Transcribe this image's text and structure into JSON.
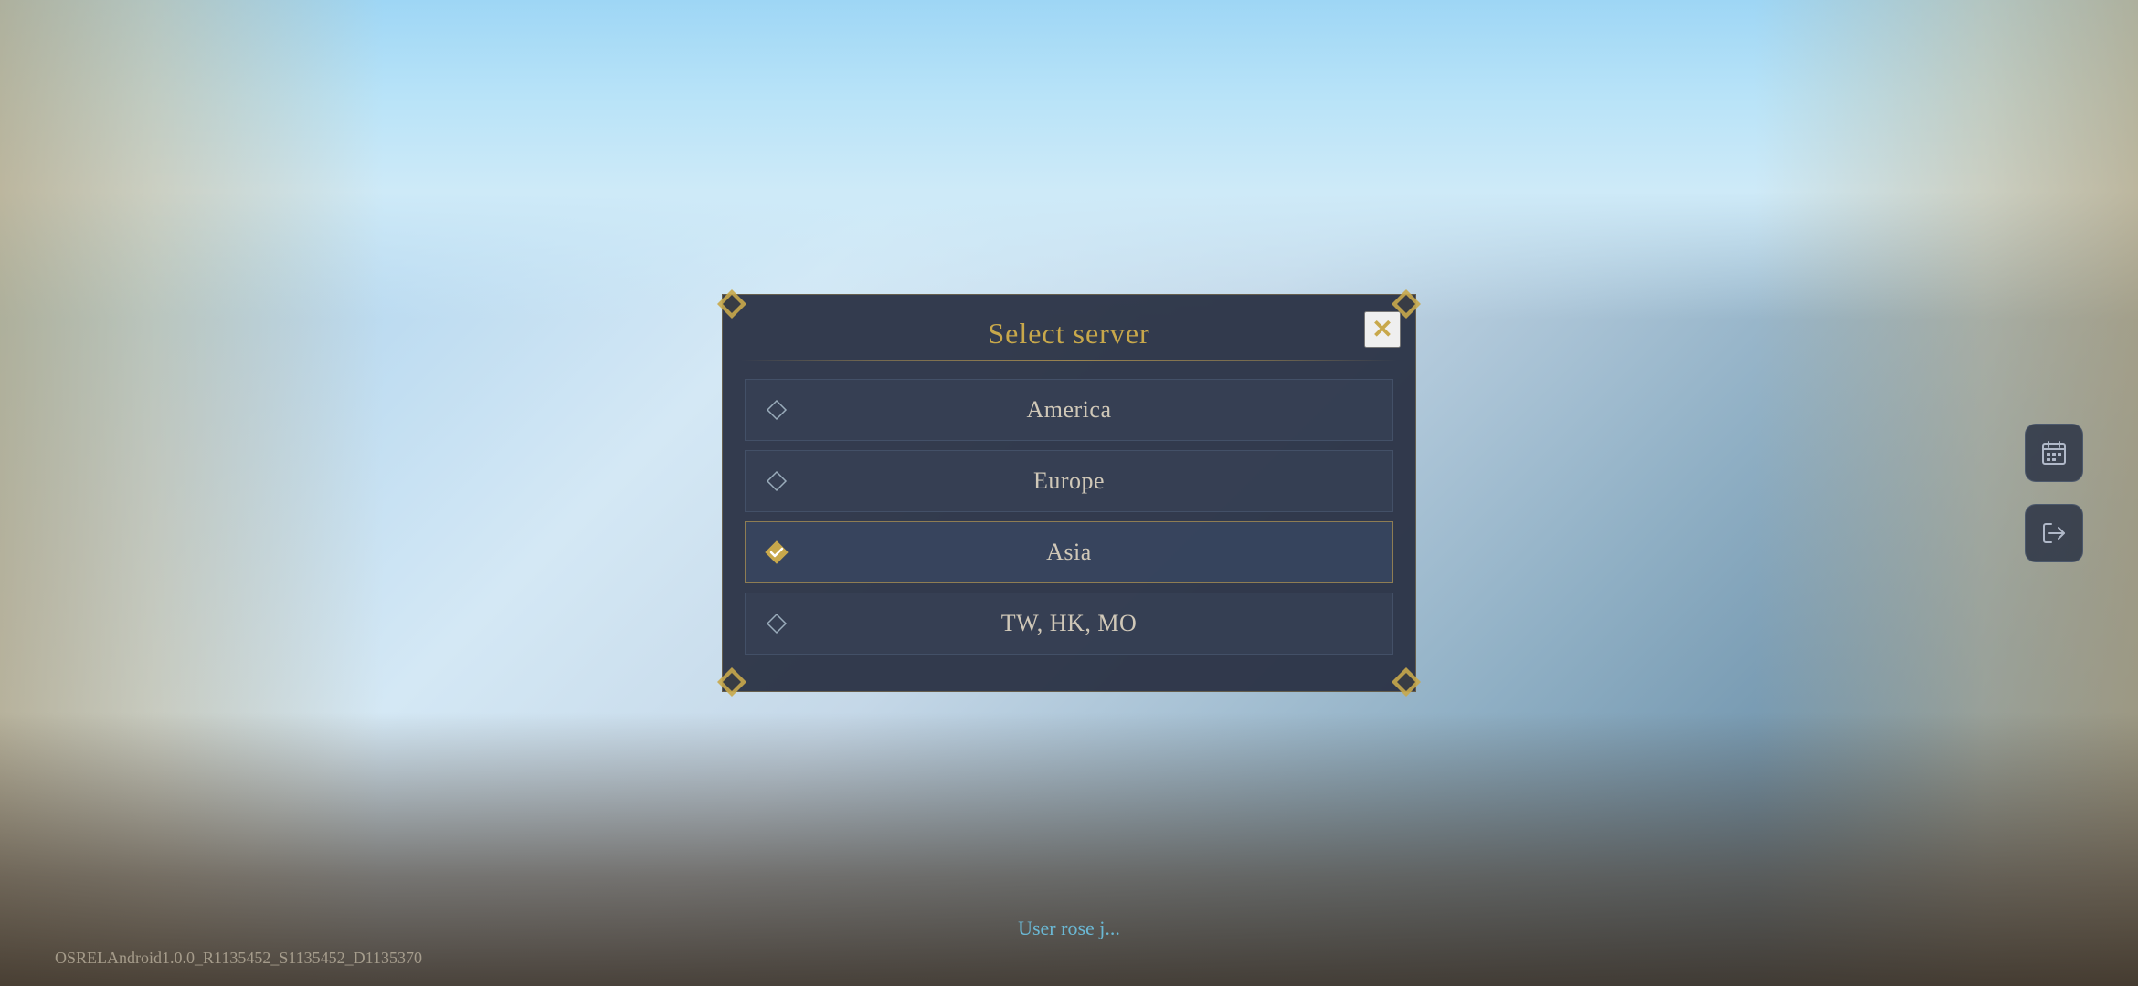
{
  "background": {
    "alt": "Fantasy game background with ancient columns and sky"
  },
  "dialog": {
    "title": "Select server",
    "close_label": "✕",
    "servers": [
      {
        "id": "america",
        "label": "America",
        "selected": false
      },
      {
        "id": "europe",
        "label": "Europe",
        "selected": false
      },
      {
        "id": "asia",
        "label": "Asia",
        "selected": true
      },
      {
        "id": "tw-hk-mo",
        "label": "TW, HK, MO",
        "selected": false
      }
    ]
  },
  "footer": {
    "user_text": "User rose j...",
    "version_text": "OSRELAndroid1.0.0_R1135452_S1135452_D1135370"
  },
  "icons": {
    "calendar_icon": "📋",
    "logout_icon": "🔄"
  },
  "colors": {
    "gold": "#c8a84b",
    "selected_border": "#c8a84b",
    "dialog_bg": "rgba(42, 50, 68, 0.95)",
    "user_text": "#6bb8d4"
  }
}
